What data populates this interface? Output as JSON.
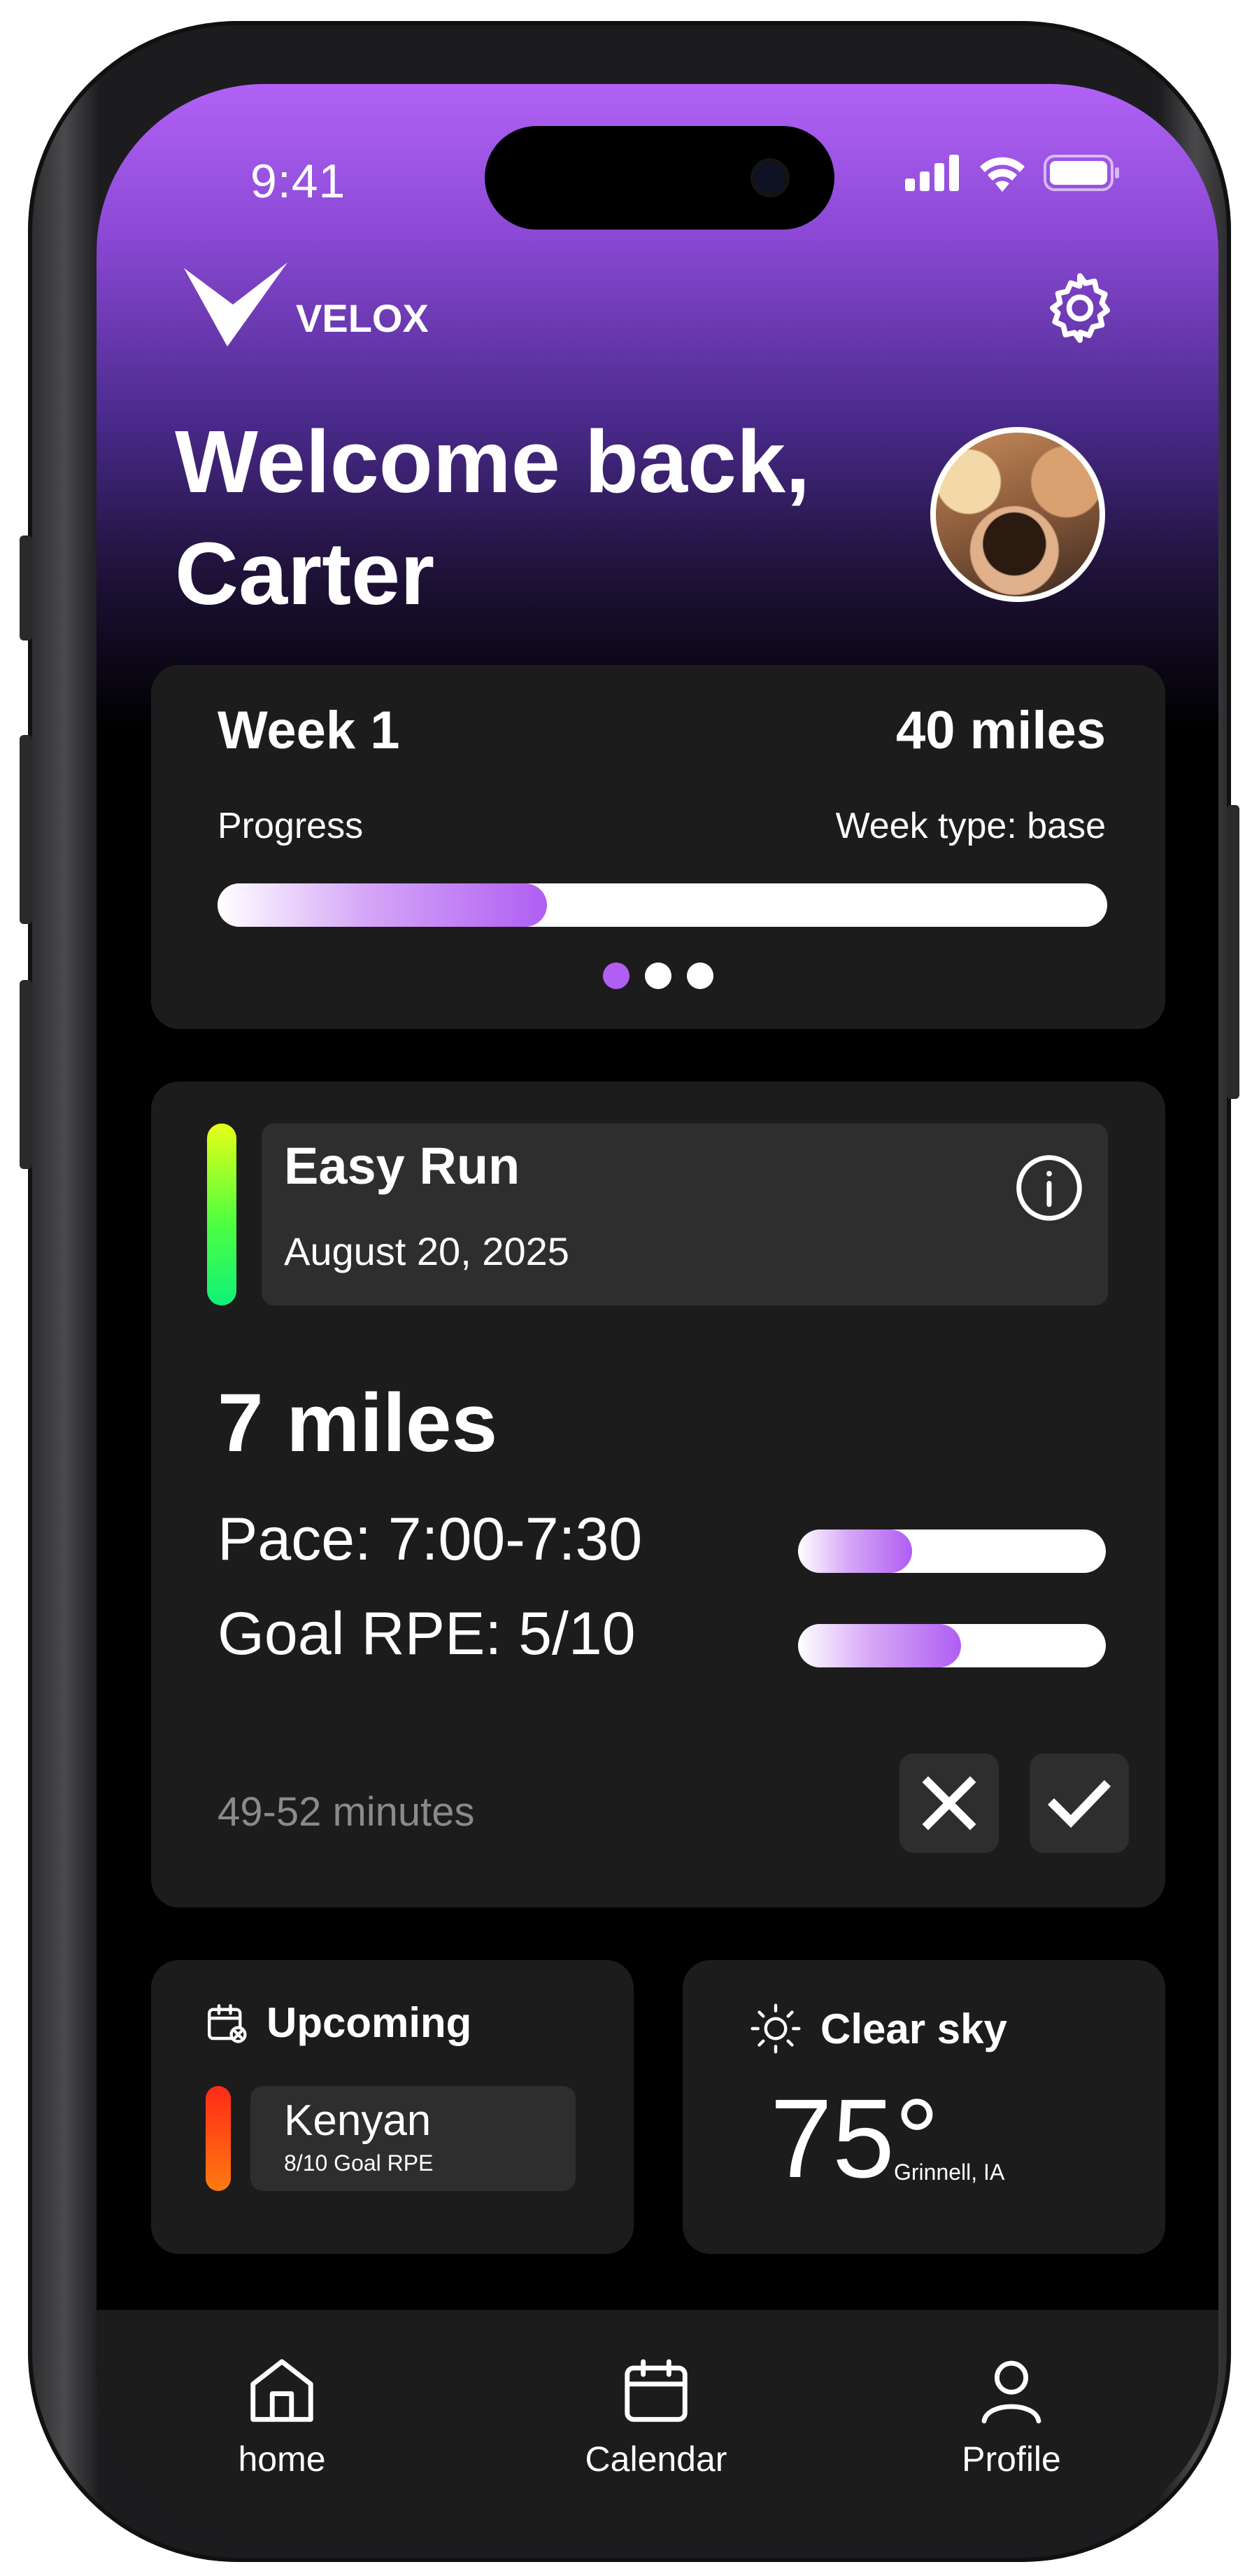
{
  "status_bar": {
    "time": "9:41"
  },
  "header": {
    "brand": "VELOX",
    "greeting_line1": "Welcome back,",
    "greeting_line2": "Carter"
  },
  "week_card": {
    "title": "Week 1",
    "mileage": "40 miles",
    "progress_label": "Progress",
    "week_type": "Week type: base",
    "progress_fraction": 0.37,
    "page_count": 3,
    "active_page": 1
  },
  "run_card": {
    "title": "Easy Run",
    "date": "August 20, 2025",
    "distance": "7 miles",
    "pace": "Pace: 7:00-7:30",
    "pace_fraction": 0.37,
    "rpe": "Goal RPE: 5/10",
    "rpe_fraction": 0.53,
    "duration": "49-52 minutes"
  },
  "upcoming": {
    "title": "Upcoming",
    "name": "Kenyan",
    "rpe": "8/10 Goal RPE"
  },
  "weather": {
    "condition": "Clear sky",
    "temperature": "75°",
    "city": "Grinnell, IA"
  },
  "tabs": [
    {
      "label": "home"
    },
    {
      "label": "Calendar"
    },
    {
      "label": "Profile"
    }
  ],
  "colors": {
    "accent": "#b05ef3",
    "easy_run": "#4dff40",
    "hard_run": "#ff4a14"
  }
}
